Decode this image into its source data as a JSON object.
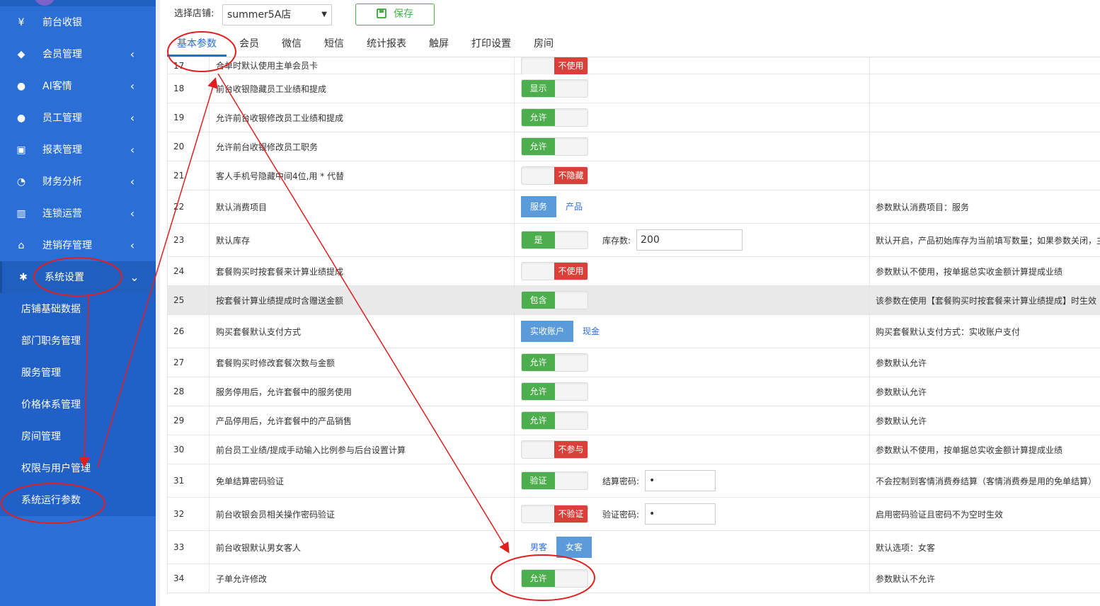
{
  "sidebar": {
    "items": [
      {
        "label": "前台收银",
        "icon": "cash-icon",
        "arrow": ""
      },
      {
        "label": "会员管理",
        "icon": "diamond-icon",
        "arrow": "‹"
      },
      {
        "label": "AI客情",
        "icon": "user-search-icon",
        "arrow": "‹"
      },
      {
        "label": "员工管理",
        "icon": "user-icon",
        "arrow": "‹"
      },
      {
        "label": "报表管理",
        "icon": "monitor-icon",
        "arrow": "‹"
      },
      {
        "label": "财务分析",
        "icon": "pie-icon",
        "arrow": "‹"
      },
      {
        "label": "连锁运营",
        "icon": "building-icon",
        "arrow": "‹"
      },
      {
        "label": "进销存管理",
        "icon": "home-icon",
        "arrow": "‹"
      },
      {
        "label": "系统设置",
        "icon": "gear-icon",
        "arrow": "⌄"
      }
    ],
    "subitems": [
      "店铺基础数据",
      "部门职务管理",
      "服务管理",
      "价格体系管理",
      "房间管理",
      "权限与用户管理",
      "系统运行参数"
    ]
  },
  "toolbar": {
    "shop_label": "选择店铺:",
    "shop_value": "summer5A店",
    "save_label": "保存"
  },
  "tabs": [
    "基本参数",
    "会员",
    "微信",
    "短信",
    "统计报表",
    "触屏",
    "打印设置",
    "房间"
  ],
  "rows": [
    {
      "no": "17",
      "name": "合单时默认使用主单会员卡",
      "ctl": {
        "type": "switch",
        "state": "off",
        "label": "不使用"
      },
      "desc": ""
    },
    {
      "no": "18",
      "name": "前台收银隐藏员工业绩和提成",
      "ctl": {
        "type": "switch",
        "state": "on",
        "label": "显示"
      },
      "desc": ""
    },
    {
      "no": "19",
      "name": "允许前台收银修改员工业绩和提成",
      "ctl": {
        "type": "switch",
        "state": "on",
        "label": "允许"
      },
      "desc": ""
    },
    {
      "no": "20",
      "name": "允许前台收银修改员工职务",
      "ctl": {
        "type": "switch",
        "state": "on",
        "label": "允许"
      },
      "desc": ""
    },
    {
      "no": "21",
      "name": "客人手机号隐藏中间4位,用 * 代替",
      "ctl": {
        "type": "switch",
        "state": "off",
        "label": "不隐藏"
      },
      "desc": ""
    },
    {
      "no": "22",
      "name": "默认消费项目",
      "ctl": {
        "type": "segment",
        "options": [
          "服务",
          "产品"
        ],
        "selected": 0
      },
      "desc": "参数默认消费项目：服务"
    },
    {
      "no": "23",
      "name": "默认库存",
      "ctl": {
        "type": "switch",
        "state": "on",
        "label": "是",
        "extra_label": "库存数:",
        "extra_value": "200"
      },
      "desc": "默认开启，产品初始库存为当前填写数量；如果参数关闭，主"
    },
    {
      "no": "24",
      "name": "套餐购买时按套餐来计算业绩提成",
      "ctl": {
        "type": "switch",
        "state": "off",
        "label": "不使用"
      },
      "desc": "参数默认不使用，按单据总实收金额计算提成业绩"
    },
    {
      "no": "25",
      "name": "按套餐计算业绩提成时含赠送金额",
      "ctl": {
        "type": "switch",
        "state": "on",
        "label": "包含"
      },
      "desc": "该参数在使用【套餐购买时按套餐来计算业绩提成】时生效"
    },
    {
      "no": "26",
      "name": "购买套餐默认支付方式",
      "ctl": {
        "type": "segment",
        "options": [
          "实收账户",
          "现金"
        ],
        "selected": 0
      },
      "desc": "购买套餐默认支付方式：实收账户支付"
    },
    {
      "no": "27",
      "name": "套餐购买时修改套餐次数与金额",
      "ctl": {
        "type": "switch",
        "state": "on",
        "label": "允许"
      },
      "desc": "参数默认允许"
    },
    {
      "no": "28",
      "name": "服务停用后，允许套餐中的服务使用",
      "ctl": {
        "type": "switch",
        "state": "on",
        "label": "允许"
      },
      "desc": "参数默认允许"
    },
    {
      "no": "29",
      "name": "产品停用后，允许套餐中的产品销售",
      "ctl": {
        "type": "switch",
        "state": "on",
        "label": "允许"
      },
      "desc": "参数默认允许"
    },
    {
      "no": "30",
      "name": "前台员工业绩/提成手动输入比例参与后台设置计算",
      "ctl": {
        "type": "switch",
        "state": "off",
        "label": "不参与"
      },
      "desc": "参数默认不使用，按单据总实收金额计算提成业绩"
    },
    {
      "no": "31",
      "name": "免单结算密码验证",
      "ctl": {
        "type": "switch",
        "state": "on",
        "label": "验证",
        "extra_label": "结算密码:",
        "extra_value": "•"
      },
      "desc": "不会控制到客情消费券结算（客情消费券是用的免单结算）"
    },
    {
      "no": "32",
      "name": "前台收银会员相关操作密码验证",
      "ctl": {
        "type": "switch",
        "state": "off",
        "label": "不验证",
        "extra_label": "验证密码:",
        "extra_value": "•"
      },
      "desc": "启用密码验证且密码不为空时生效"
    },
    {
      "no": "33",
      "name": "前台收银默认男女客人",
      "ctl": {
        "type": "segment",
        "options": [
          "男客",
          "女客"
        ],
        "selected": 1
      },
      "desc": "默认选项：女客"
    },
    {
      "no": "34",
      "name": "子单允许修改",
      "ctl": {
        "type": "switch",
        "state": "on",
        "label": "允许"
      },
      "desc": "参数默认不允许"
    }
  ],
  "colors": {
    "sidebar": "#2b6fd6",
    "accent": "#2b6fd6",
    "on": "#4cae4c",
    "off": "#d9403a",
    "annotation": "#e02020"
  }
}
